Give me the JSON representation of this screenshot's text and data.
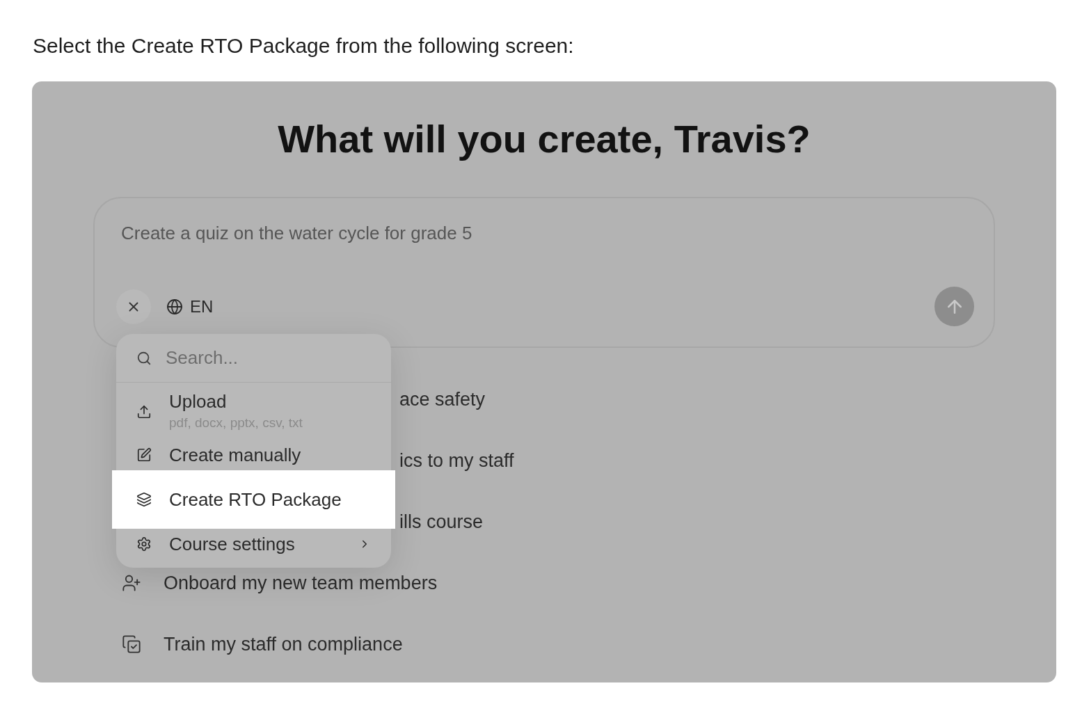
{
  "instruction": "Select the Create RTO Package from the following screen:",
  "screen": {
    "heading": "What will you create, Travis?",
    "prompt": {
      "placeholder": "Create a quiz on the water cycle for grade 5",
      "language": "EN"
    },
    "menu": {
      "search": {
        "placeholder": "Search..."
      },
      "items": [
        {
          "kind": "upload",
          "label": "Upload",
          "formats": "pdf, docx, pptx, csv, txt",
          "selected": false,
          "submenu": false
        },
        {
          "kind": "manual",
          "label": "Create manually",
          "selected": false,
          "submenu": false
        },
        {
          "kind": "package",
          "label": "Create RTO Package",
          "selected": true,
          "submenu": false
        },
        {
          "kind": "settings",
          "label": "Course settings",
          "selected": false,
          "submenu": true
        }
      ]
    },
    "suggestions": [
      {
        "text": "ace safety",
        "covered": true
      },
      {
        "text": "ics to my staff",
        "covered": true
      },
      {
        "text": "ills course",
        "covered": true
      },
      {
        "text": "Onboard my new team members",
        "covered": false
      },
      {
        "text": "Train my staff on compliance",
        "covered": false
      }
    ]
  }
}
